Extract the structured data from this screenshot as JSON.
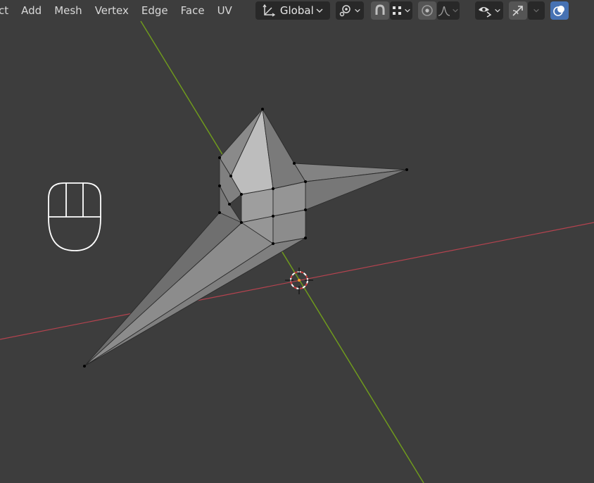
{
  "menubar": {
    "items": [
      "ct",
      "Add",
      "Mesh",
      "Vertex",
      "Edge",
      "Face",
      "UV"
    ]
  },
  "toolbar": {
    "transform_orientation": "Global",
    "icons": {
      "orientation": "transform-orientation-icon",
      "pivot": "pivot-point-icon",
      "snap_toggle": "magnet-snap-icon",
      "snap_target": "snap-increment-icon",
      "proportional": "proportional-editing-icon",
      "falloff": "falloff-curve-icon",
      "visibility": "eye-visibility-icon",
      "gizmo": "gizmo-arrow-icon",
      "overlay": "overlay-icon"
    }
  },
  "colors": {
    "viewport_bg": "#3d3d3d",
    "x_axis": "#b5434f",
    "y_axis": "#6f9a1d",
    "mesh_face": "#8e8e8e",
    "mesh_face_light": "#b4b4b4",
    "header_text": "#d8d8d8",
    "accent_blue": "#4772b3"
  }
}
